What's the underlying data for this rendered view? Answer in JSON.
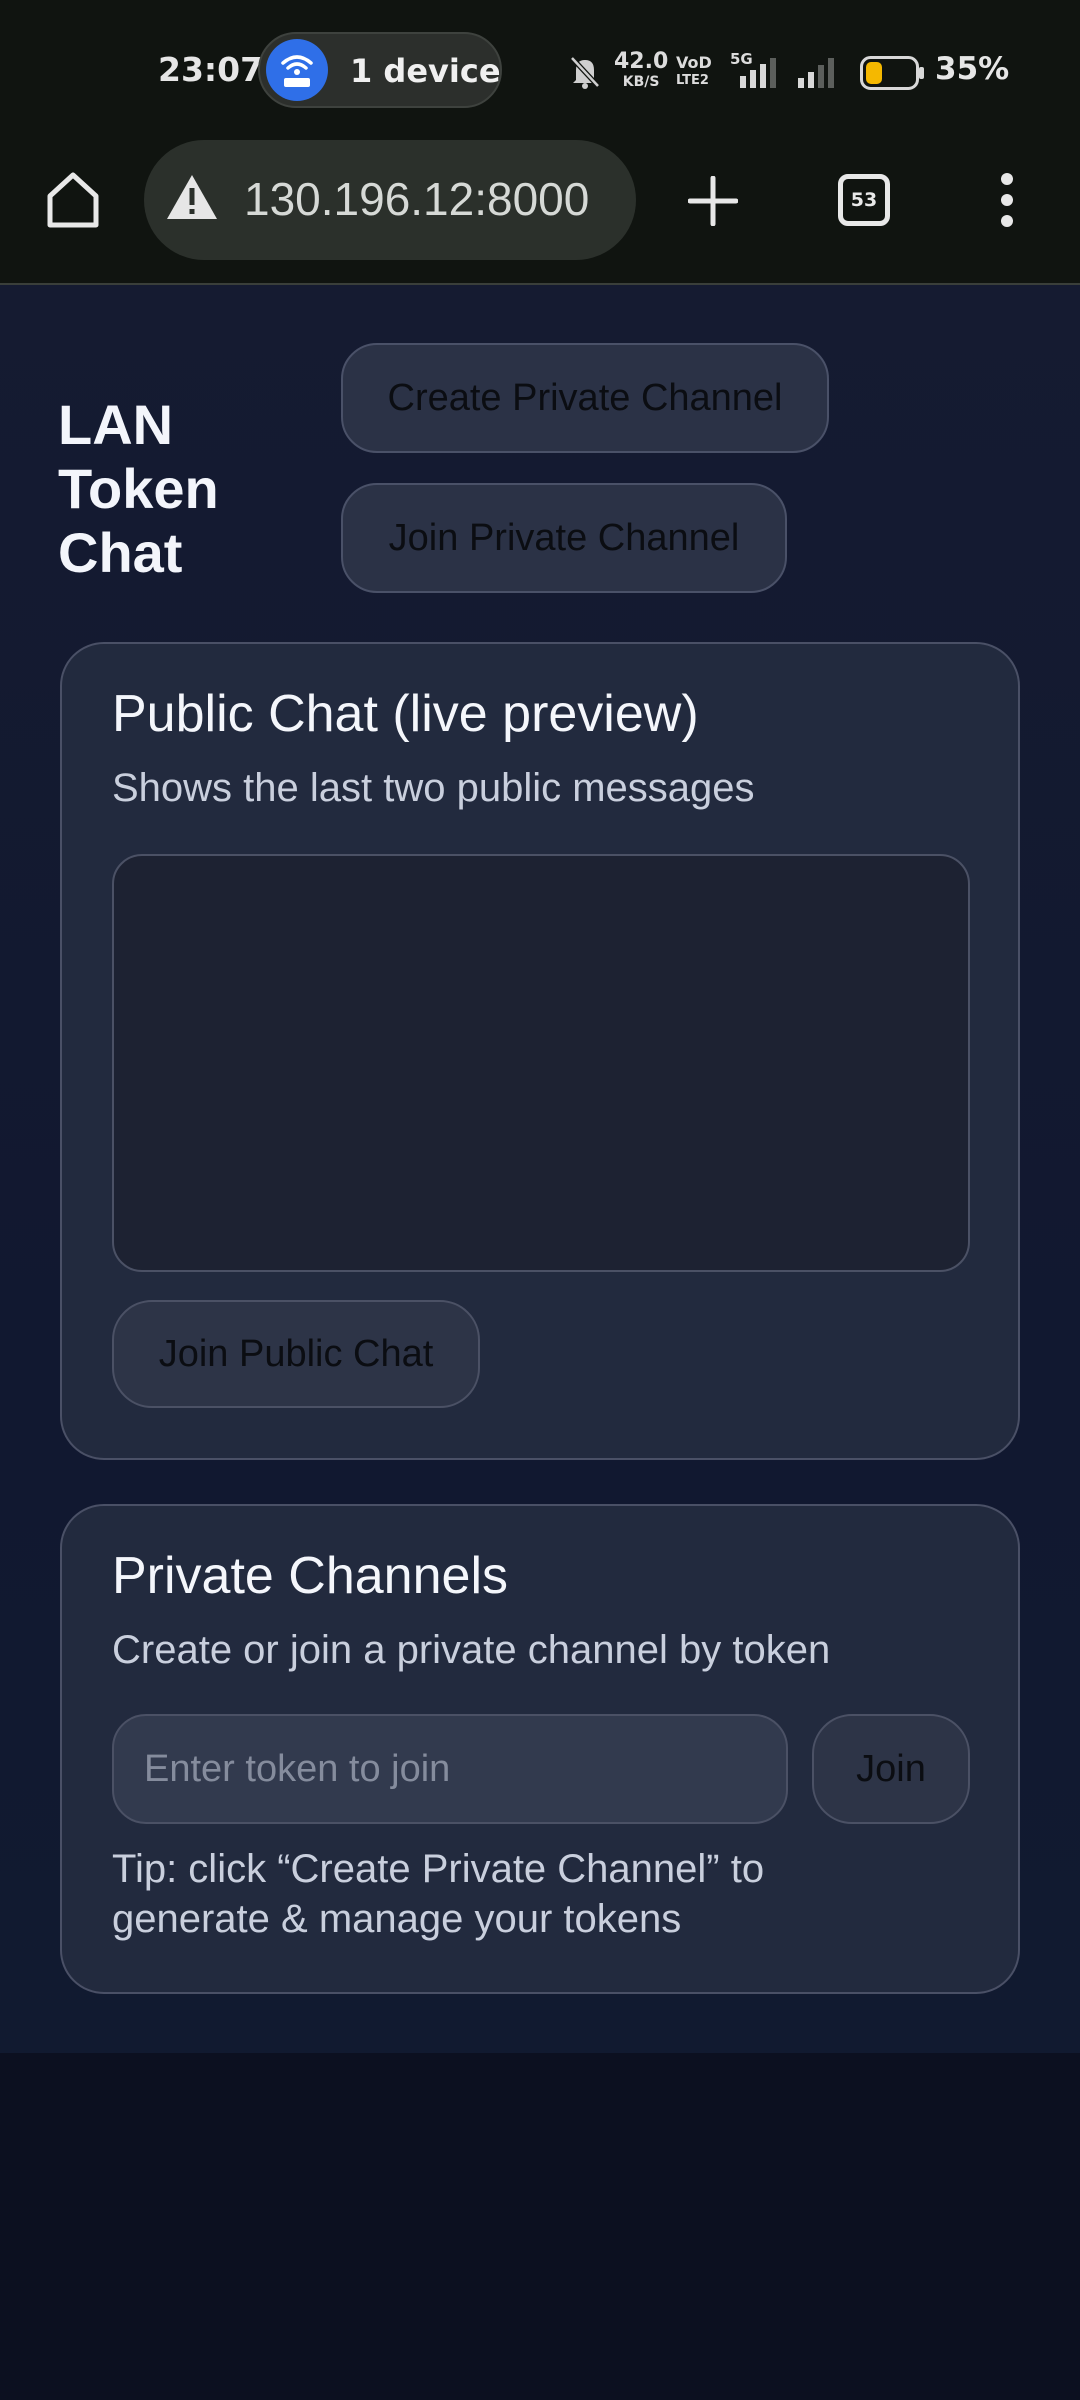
{
  "status_bar": {
    "time": "23:07",
    "hotspot_label": "1 device",
    "net_speed_value": "42.0",
    "net_speed_unit": "KB/S",
    "volte_line1": "VoD",
    "volte_line2": "LTE2",
    "network_type": "5G",
    "battery_percent": "35%",
    "battery_level": 0.35,
    "icons": [
      "hotspot-icon",
      "silent-bell-icon",
      "signal-icon",
      "signal-icon",
      "battery-icon"
    ]
  },
  "browser": {
    "url": "130.196.12:8000",
    "tab_count": "53",
    "icons": [
      "home-icon",
      "warning-icon",
      "plus-icon",
      "tabs-icon",
      "more-vert-icon"
    ]
  },
  "header": {
    "app_title": "LAN Token Chat",
    "create_private_label": "Create Private Channel",
    "join_private_label": "Join Private Channel"
  },
  "public_chat": {
    "title": "Public Chat (live preview)",
    "subtitle": "Shows the last two public messages",
    "join_label": "Join Public Chat"
  },
  "private_channels": {
    "title": "Private Channels",
    "subtitle": "Create or  join a private channel by token",
    "token_placeholder": "Enter token to join",
    "token_value": "",
    "join_label": "Join",
    "tip": "Tip: click “Create Private Channel” to generate & manage your tokens"
  },
  "colors": {
    "page_bg": "#111830",
    "card_bg": "#222a3e",
    "card_border": "#4a5066",
    "browser_bg": "#101410",
    "hotspot_blue": "#2f6fe8",
    "battery_yellow": "#f5b800"
  }
}
